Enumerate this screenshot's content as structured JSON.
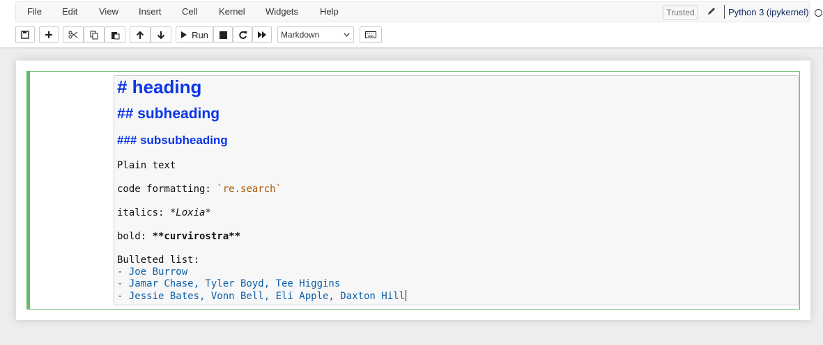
{
  "menu": {
    "items": [
      "File",
      "Edit",
      "View",
      "Insert",
      "Cell",
      "Kernel",
      "Widgets",
      "Help"
    ],
    "trusted_label": "Trusted",
    "kernel_name": "Python 3 (ipykernel)"
  },
  "toolbar": {
    "run_label": "Run",
    "cell_type": "Markdown"
  },
  "cell": {
    "h1": "# heading",
    "h2": "## subheading",
    "h3": "### subsubheading",
    "plain": "Plain text",
    "code_prefix": "code formatting: ",
    "code_value": "`re.search`",
    "italics_prefix": "italics: ",
    "italics_value": "*Loxia*",
    "bold_prefix": "bold: ",
    "bold_value": "**curvirostra**",
    "bulleted_heading": "Bulleted list:",
    "bullets": [
      "- Joe Burrow",
      "- Jamar Chase, Tyler Boyd, Tee Higgins",
      "- Jessie Bates, Vonn Bell, Eli Apple, Daxton Hill"
    ]
  },
  "colors": {
    "heading": "#0b35e8",
    "code": "#a55a00",
    "list": "#0b5fa8",
    "selected_cell_border": "#66bb6a"
  }
}
